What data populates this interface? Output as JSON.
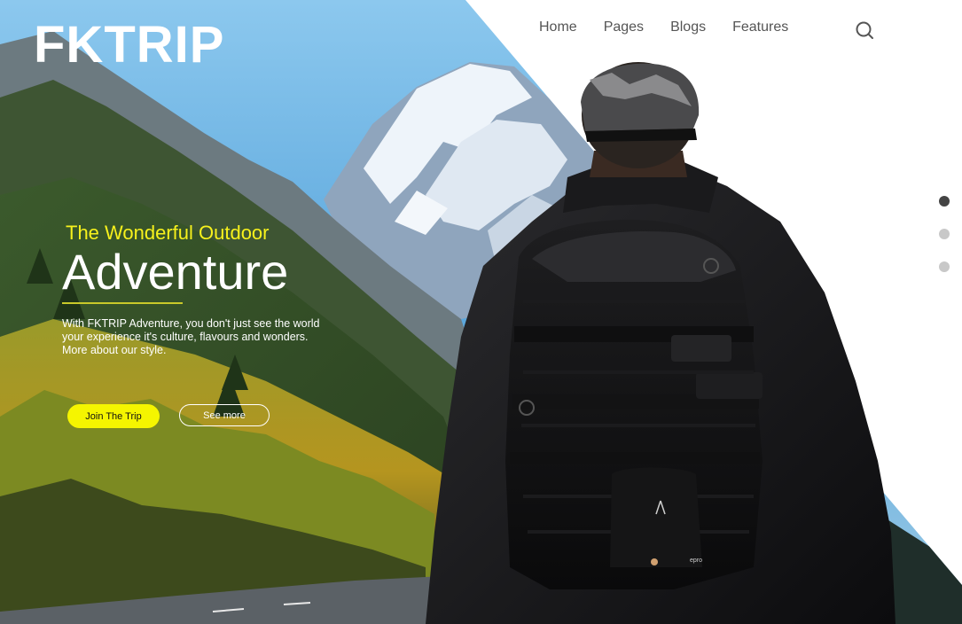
{
  "brand": {
    "logo_text": "FKTRIP"
  },
  "nav": {
    "items": [
      {
        "label": "Home"
      },
      {
        "label": "Pages"
      },
      {
        "label": "Blogs"
      },
      {
        "label": "Features"
      }
    ],
    "search_icon": "search-icon"
  },
  "hero": {
    "tagline": "The Wonderful Outdoor",
    "headline": "Adventure",
    "description_lines": [
      "With FKTRIP Adventure, you don't just see the world",
      "your experience it's culture, flavours and wonders.",
      "More about our style."
    ],
    "primary_button": "Join The Trip",
    "secondary_button": "See more",
    "backpack_brand": "epro"
  },
  "slider": {
    "total": 3,
    "active": 1
  },
  "colors": {
    "accent_yellow": "#f5f500",
    "tagline_yellow": "#f7f11c",
    "nav_text": "#555555",
    "dot_active": "#444444",
    "dot_inactive": "#c8c8c8"
  }
}
